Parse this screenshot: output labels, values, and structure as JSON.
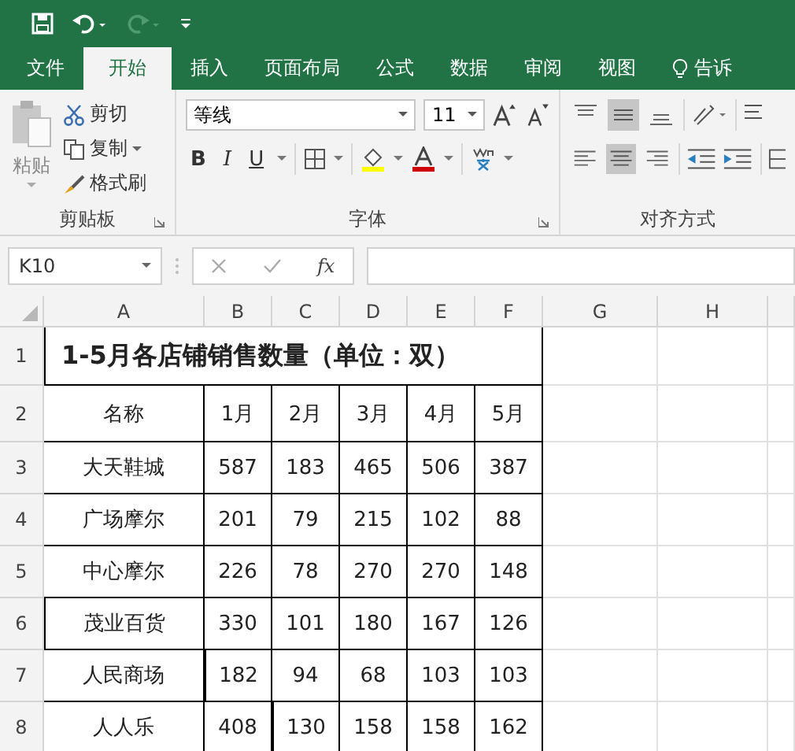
{
  "tabs": [
    {
      "label": "文件",
      "selected": false
    },
    {
      "label": "开始",
      "selected": true
    },
    {
      "label": "插入",
      "selected": false
    },
    {
      "label": "页面布局",
      "selected": false
    },
    {
      "label": "公式",
      "selected": false
    },
    {
      "label": "数据",
      "selected": false
    },
    {
      "label": "审阅",
      "selected": false
    },
    {
      "label": "视图",
      "selected": false
    }
  ],
  "tell_me": "告诉",
  "clipboard": {
    "paste": "粘贴",
    "cut": "剪切",
    "copy": "复制",
    "format_painter": "格式刷",
    "label": "剪贴板"
  },
  "font": {
    "font_name": "等线",
    "font_size": "11",
    "bold": "B",
    "italic": "I",
    "underline": "U",
    "label": "字体"
  },
  "alignment": {
    "label": "对齐方式"
  },
  "formula_bar": {
    "name_box": "K10",
    "fx": "fx"
  },
  "columns": [
    "A",
    "B",
    "C",
    "D",
    "E",
    "F",
    "G",
    "H"
  ],
  "row_numbers": [
    "1",
    "2",
    "3",
    "4",
    "5",
    "6",
    "7",
    "8"
  ],
  "sheet": {
    "title": "1-5月各店铺销售数量（单位：双）",
    "header": [
      "名称",
      "1月",
      "2月",
      "3月",
      "4月",
      "5月"
    ],
    "rows": [
      [
        "大天鞋城",
        "587",
        "183",
        "465",
        "506",
        "387"
      ],
      [
        "广场摩尔",
        "201",
        "79",
        "215",
        "102",
        "88"
      ],
      [
        "中心摩尔",
        "226",
        "78",
        "270",
        "270",
        "148"
      ],
      [
        "茂业百货",
        "330",
        "101",
        "180",
        "167",
        "126"
      ],
      [
        "人民商场",
        "182",
        "94",
        "68",
        "103",
        "103"
      ],
      [
        "人人乐",
        "408",
        "130",
        "158",
        "158",
        "162"
      ]
    ]
  }
}
